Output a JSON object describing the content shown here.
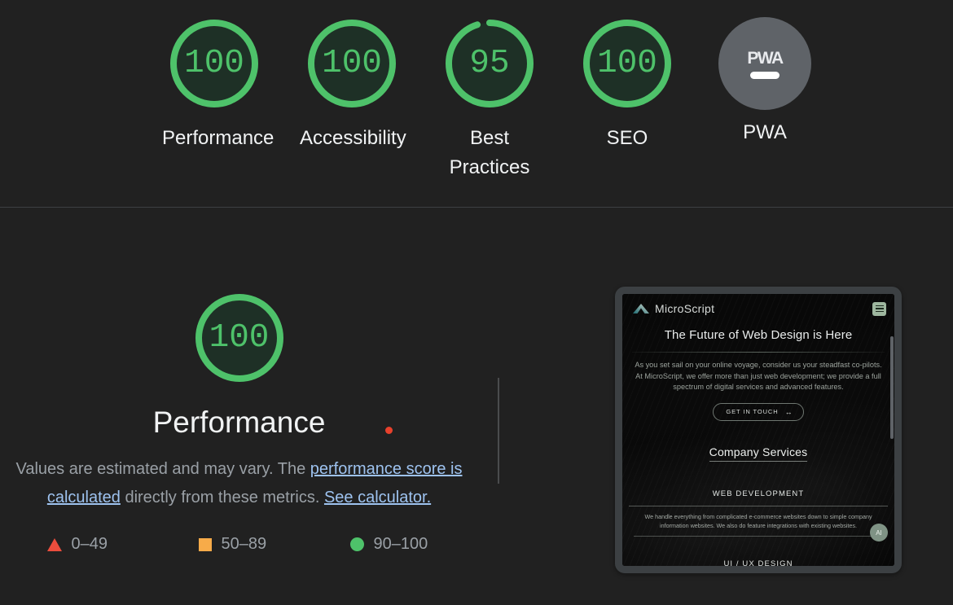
{
  "report": {
    "summary_categories": [
      {
        "label": "Performance",
        "score": "100",
        "score_num": 100,
        "state": "pass"
      },
      {
        "label": "Accessibility",
        "score": "100",
        "score_num": 100,
        "state": "pass"
      },
      {
        "label": "Best Practices",
        "score": "95",
        "score_num": 95,
        "state": "pass"
      },
      {
        "label": "SEO",
        "score": "100",
        "score_num": 100,
        "state": "pass"
      }
    ],
    "pwa": {
      "badge_text": "PWA",
      "label": "PWA",
      "state": "not-applicable"
    },
    "detail": {
      "score": "100",
      "score_num": 100,
      "title": "Performance",
      "disclaimer_part1": "Values are estimated and may vary. The ",
      "disclaimer_link1": "performance score is calculated",
      "disclaimer_part2": " directly from these metrics. ",
      "disclaimer_link2": "See calculator."
    },
    "legend": [
      {
        "icon": "triangle-icon",
        "color": "#ec4d3d",
        "range": "0–49"
      },
      {
        "icon": "square-icon",
        "color": "#f7ab49",
        "range": "50–89"
      },
      {
        "icon": "circle-icon",
        "color": "#4ec26a",
        "range": "90–100"
      }
    ]
  },
  "colors": {
    "pass": "#4ec26a",
    "average": "#f7ab49",
    "fail": "#ec4d3d",
    "gauge_fill": "#1e3026",
    "background": "#212121",
    "link": "#9ec3f0",
    "muted_text": "#9aa0a6",
    "cursor_dot": "#e8412c"
  },
  "thumbnail": {
    "brand": "MicroScript",
    "logo_icon": "mountain-logo-icon",
    "menu_icon": "hamburger-menu-icon",
    "headline": "The Future of Web Design is Here",
    "paragraph": "As you set sail on your online voyage, consider us your steadfast co-pilots. At MicroScript, we offer more than just web development; we provide a full spectrum of digital services and advanced features.",
    "cta_label": "GET IN TOUCH",
    "cta_icon": "double-arrow-icon",
    "section_title": "Company Services",
    "service1_title": "WEB DEVELOPMENT",
    "service1_text": "We handle everything from complicated e-commerce websites down to simple company information websites. We also do feature integrations with existing websites.",
    "service2_title": "UI / UX DESIGN",
    "ai_bubble_label": "AI"
  }
}
